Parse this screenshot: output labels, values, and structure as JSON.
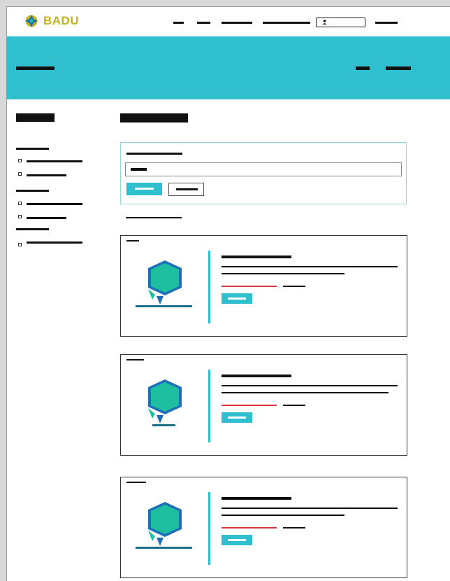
{
  "header": {
    "logo_text": "BADU",
    "nav": [
      "",
      "",
      "",
      "",
      ""
    ],
    "search_placeholder": ""
  },
  "colors": {
    "accent": "#30bfcf",
    "logo_gold": "#c5b01f",
    "badge_green": "#1dbfa0",
    "badge_blue": "#1d6fb8",
    "price_red": "#d9363e"
  },
  "icons": {
    "logo": "globe-logo-icon",
    "user": "user-icon",
    "badge": "hexagon-badge-icon",
    "checkbox": "checkbox-icon"
  }
}
